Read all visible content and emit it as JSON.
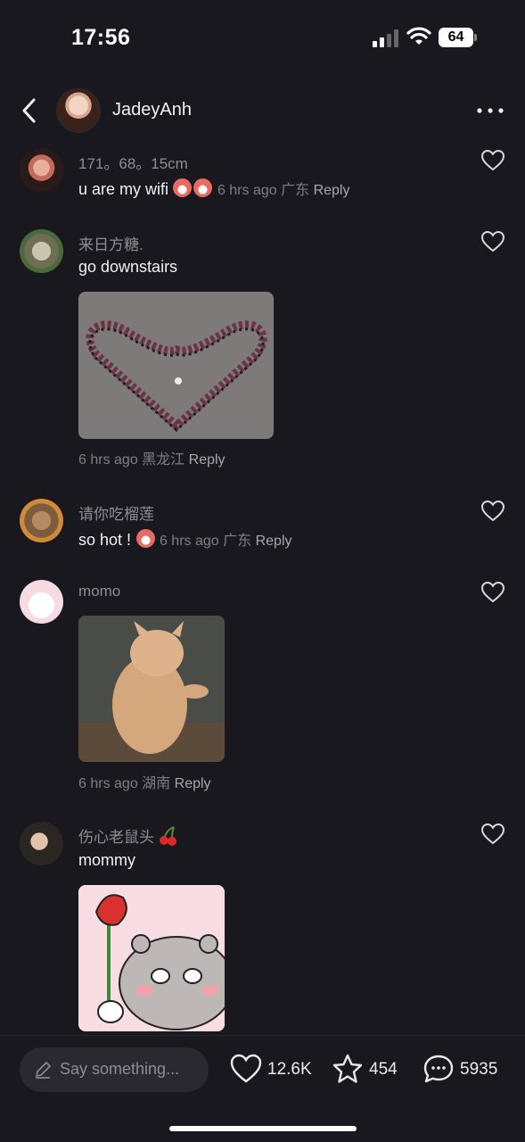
{
  "status": {
    "time": "17:56",
    "battery": "64"
  },
  "header": {
    "username": "JadeyAnh"
  },
  "comments": [
    {
      "user": "171。68。15cm",
      "text": "u are my wifi",
      "time": "6 hrs ago",
      "location": "广东",
      "reply": "Reply"
    },
    {
      "user": "来日方糖.",
      "text": "go downstairs",
      "time": "6 hrs ago",
      "location": "黑龙江",
      "reply": "Reply"
    },
    {
      "user": "请你吃榴莲",
      "text": "so hot !",
      "time": "6 hrs ago",
      "location": "广东",
      "reply": "Reply"
    },
    {
      "user": "momo",
      "text": "",
      "time": "6 hrs ago",
      "location": "湖南",
      "reply": "Reply"
    },
    {
      "user": "伤心老鼠头",
      "text": "mommy",
      "time": "",
      "location": "",
      "reply": ""
    }
  ],
  "bottom": {
    "placeholder": "Say something...",
    "likes": "12.6K",
    "favorites": "454",
    "comments": "5935"
  },
  "colors": {
    "background": "#19181e",
    "text": "#ececec",
    "muted": "#8e8d93"
  }
}
